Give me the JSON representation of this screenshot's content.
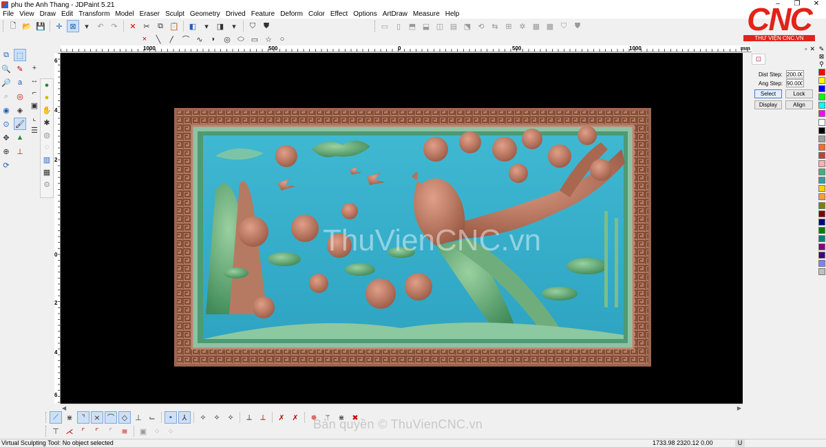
{
  "window": {
    "title": "phu the Anh Thang - JDPaint 5.21",
    "controls": [
      "–",
      "❐",
      "✕"
    ]
  },
  "menu": [
    "File",
    "View",
    "Draw",
    "Edit",
    "Transform",
    "Model",
    "Eraser",
    "Sculpt",
    "Geometry",
    "Drived",
    "Feature",
    "Deform",
    "Color",
    "Effect",
    "Options",
    "ArtDraw",
    "Measure",
    "Help"
  ],
  "logo": {
    "text": "CNC",
    "subtitle": "THƯ VIỆN CNC.VN",
    "color": "#e2231a"
  },
  "ruler": {
    "labels": [
      "1000",
      "500",
      "0",
      "500",
      "1000"
    ],
    "unit": "mm",
    "vertical_labels": [
      "6",
      "4",
      "2",
      "0",
      "2",
      "4",
      "6"
    ]
  },
  "canvas": {
    "background": "#000000",
    "watermark": "ThuVienCNC.vn"
  },
  "props_panel": {
    "dist_step_label": "Dist Step:",
    "dist_step_value": "200.000",
    "ang_step_label": "Ang Step:",
    "ang_step_value": "90.000",
    "select_button": "Select",
    "lock_button": "Lock",
    "display_button": "Display",
    "align_button": "Align"
  },
  "palette": [
    "#ff0000",
    "#ffff00",
    "#0000ff",
    "#00ff00",
    "#00ffff",
    "#ff00ff",
    "#ffffff",
    "#000000",
    "#a0a0a0",
    "#ff6a2a",
    "#c04040",
    "#ffb0b0",
    "#40b080",
    "#30a0a0",
    "#ffd000",
    "#ff9a40",
    "#808000",
    "#800000",
    "#000080",
    "#008000",
    "#008080",
    "#800080",
    "#400080",
    "#8080ff",
    "#c0c0c0"
  ],
  "copyright": "Bản quyền © ThuVienCNC.vn",
  "status": {
    "message": "Virtual Sculpting Tool: No object selected",
    "coordinates": "1733.98 2320.12 0.00",
    "unit": "U"
  }
}
